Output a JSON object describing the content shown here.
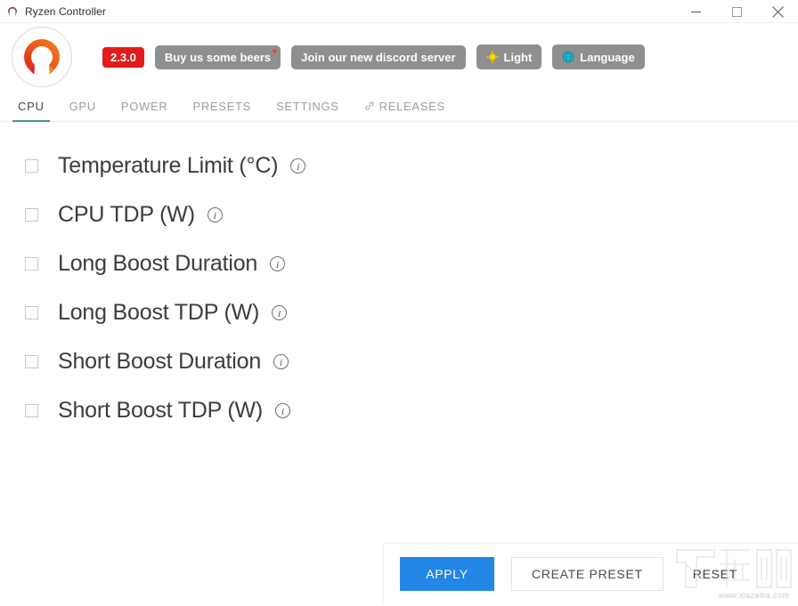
{
  "window": {
    "title": "Ryzen Controller",
    "icon": "ryzen-logo-icon",
    "controls": {
      "minimize": "minimize-icon",
      "maximize": "maximize-icon",
      "close": "close-icon"
    }
  },
  "toolbar": {
    "logo_icon": "ryzen-controller-logo",
    "version": "2.3.0",
    "buttons": [
      {
        "label": "Buy us some beers",
        "icon": "heart-icon"
      },
      {
        "label": "Join our new discord server",
        "icon": ""
      },
      {
        "label": "Light",
        "icon": "sun-icon"
      },
      {
        "label": "Language",
        "icon": "globe-icon"
      }
    ]
  },
  "tabs": [
    {
      "label": "CPU",
      "active": true,
      "icon": ""
    },
    {
      "label": "GPU",
      "active": false,
      "icon": ""
    },
    {
      "label": "POWER",
      "active": false,
      "icon": ""
    },
    {
      "label": "PRESETS",
      "active": false,
      "icon": ""
    },
    {
      "label": "SETTINGS",
      "active": false,
      "icon": ""
    },
    {
      "label": "RELEASES",
      "active": false,
      "icon": "link-icon"
    }
  ],
  "settings": {
    "rows": [
      {
        "label": "Temperature Limit (°C)",
        "checked": false,
        "info": "i"
      },
      {
        "label": "CPU TDP (W)",
        "checked": false,
        "info": "i"
      },
      {
        "label": "Long Boost Duration",
        "checked": false,
        "info": "i"
      },
      {
        "label": "Long Boost TDP (W)",
        "checked": false,
        "info": "i"
      },
      {
        "label": "Short Boost Duration",
        "checked": false,
        "info": "i"
      },
      {
        "label": "Short Boost TDP (W)",
        "checked": false,
        "info": "i"
      }
    ]
  },
  "actions": {
    "apply": "APPLY",
    "create_preset": "CREATE PRESET",
    "reset": "RESET"
  },
  "watermark": {
    "url": "www.xiazaiba.com"
  },
  "colors": {
    "accent_blue": "#2286e6",
    "tab_underline": "#4a8fa8",
    "version_red": "#e21b1b",
    "pill_gray": "#8f8f8f",
    "logo_red": "#e0301e",
    "logo_orange": "#f26a21",
    "sun_yellow": "#f5d518",
    "globe_cyan": "#1fc4e8",
    "heart_red": "#e8413a"
  }
}
